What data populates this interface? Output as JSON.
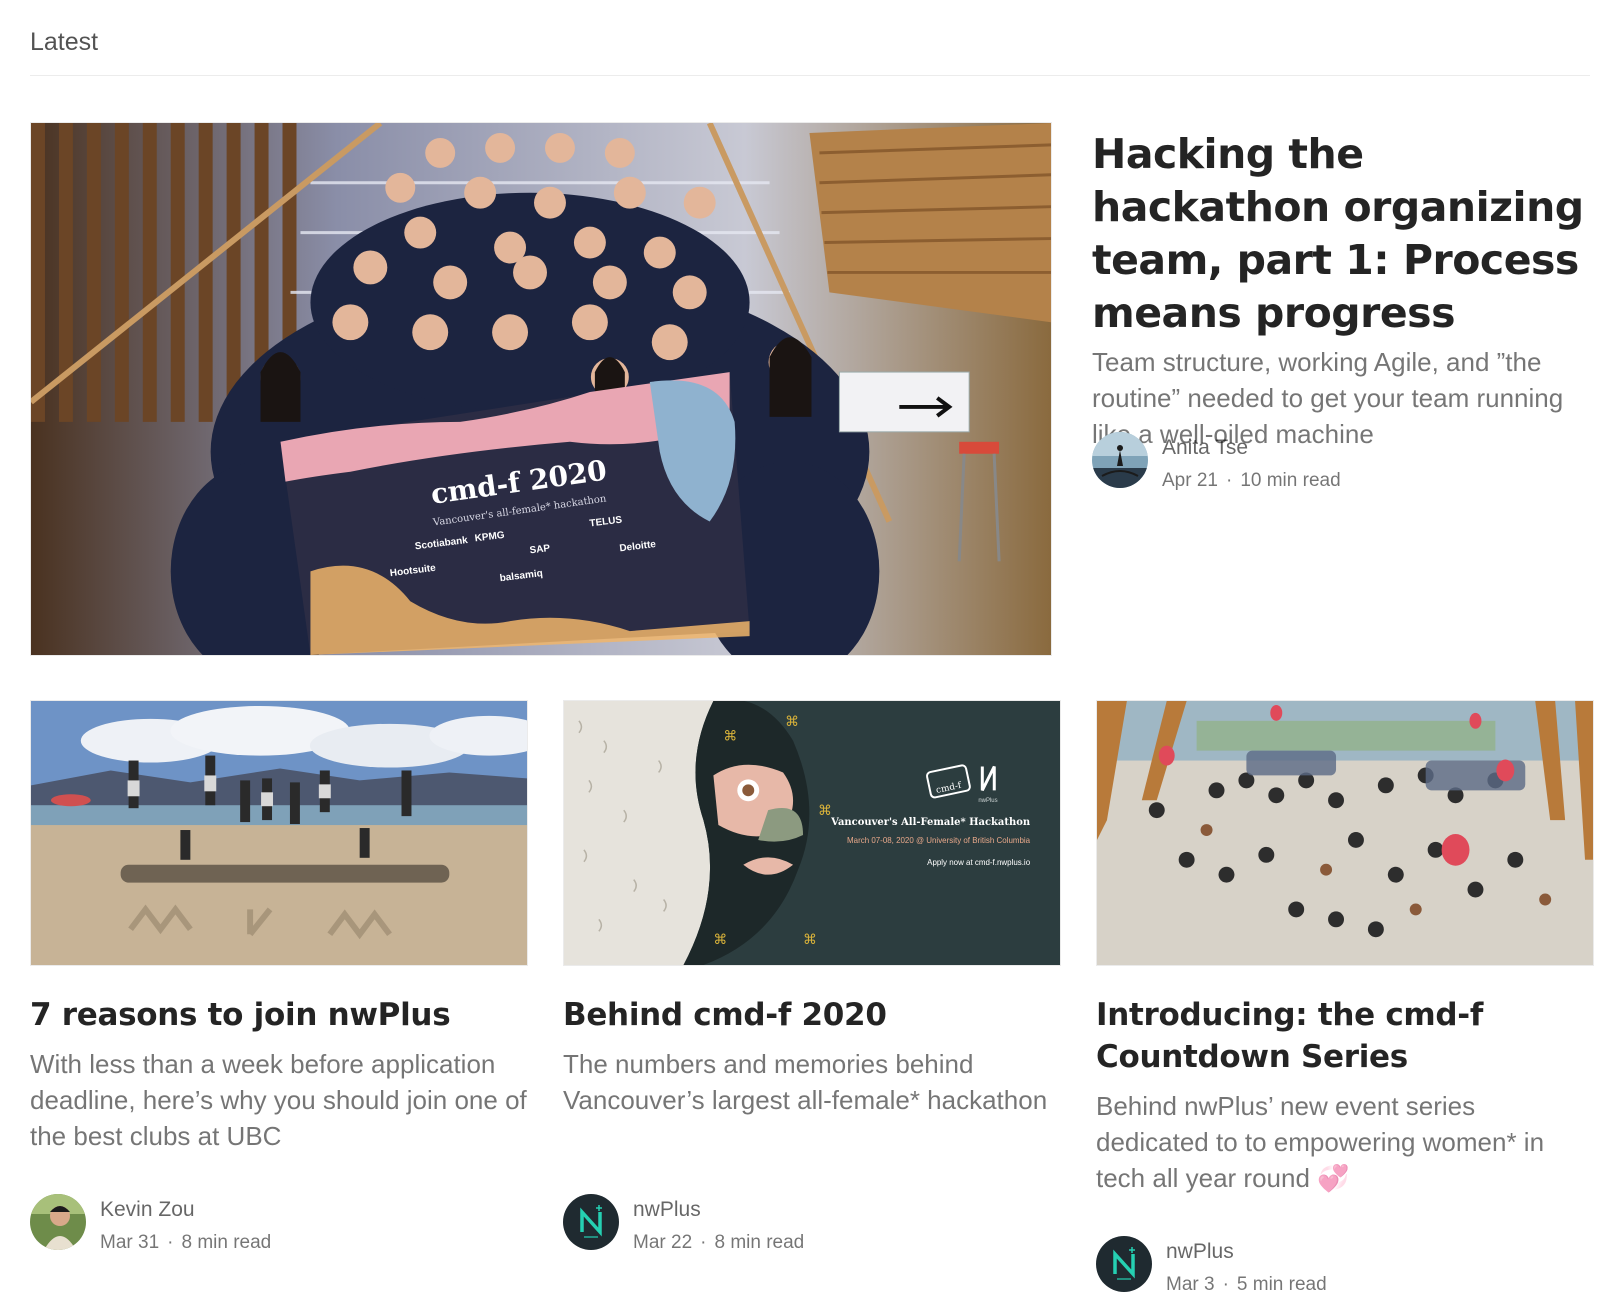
{
  "section": {
    "title": "Latest"
  },
  "featured": {
    "title": "Hacking the hackathon organizing team, part 1: Process means progress",
    "subtitle": "Team structure, working Agile, and ”the routine” needed to get your team running like a well-oiled machine",
    "author": "Anita Tse",
    "date": "Apr 21",
    "read_time": "10 min read",
    "image": {
      "banner_title": "cmd-f 2020",
      "banner_subtitle": "Vancouver's all-female* hackathon",
      "sponsors": [
        "Scotiabank",
        "KPMG",
        "TELUS",
        "Hootsuite",
        "SAP",
        "balsamiq",
        "Deloitte"
      ]
    }
  },
  "cards": [
    {
      "title": "7 reasons to join nwPlus",
      "subtitle": "With less than a week before application deadline, here’s why you should join one of the best clubs at UBC",
      "author": "Kevin Zou",
      "date": "Mar 31",
      "read_time": "8 min read"
    },
    {
      "title": "Behind cmd-f 2020",
      "subtitle": "The numbers and memories behind Vancouver’s largest all-female* hackathon",
      "author": "nwPlus",
      "date": "Mar 22",
      "read_time": "8 min read",
      "image": {
        "headline": "Vancouver's All-Female* Hackathon",
        "dateline": "March 07-08, 2020 @ University of British Columbia",
        "cta": "Apply now at cmd-f.nwplus.io",
        "logo_text": "cmd-f",
        "brand_small": "nwPlus"
      }
    },
    {
      "title": "Introducing: the cmd-f Countdown Series",
      "subtitle": "Behind nwPlus’ new event series dedicated to to empowering women* in tech all year round 💞",
      "author": "nwPlus",
      "date": "Mar 3",
      "read_time": "5 min read"
    }
  ],
  "separator": "·",
  "colors": {
    "nwplus_dark": "#1f2a30",
    "nwplus_accent": "#25d0b2",
    "poster_bg": "#2c3d3f",
    "poster_gold": "#d8b23a"
  }
}
